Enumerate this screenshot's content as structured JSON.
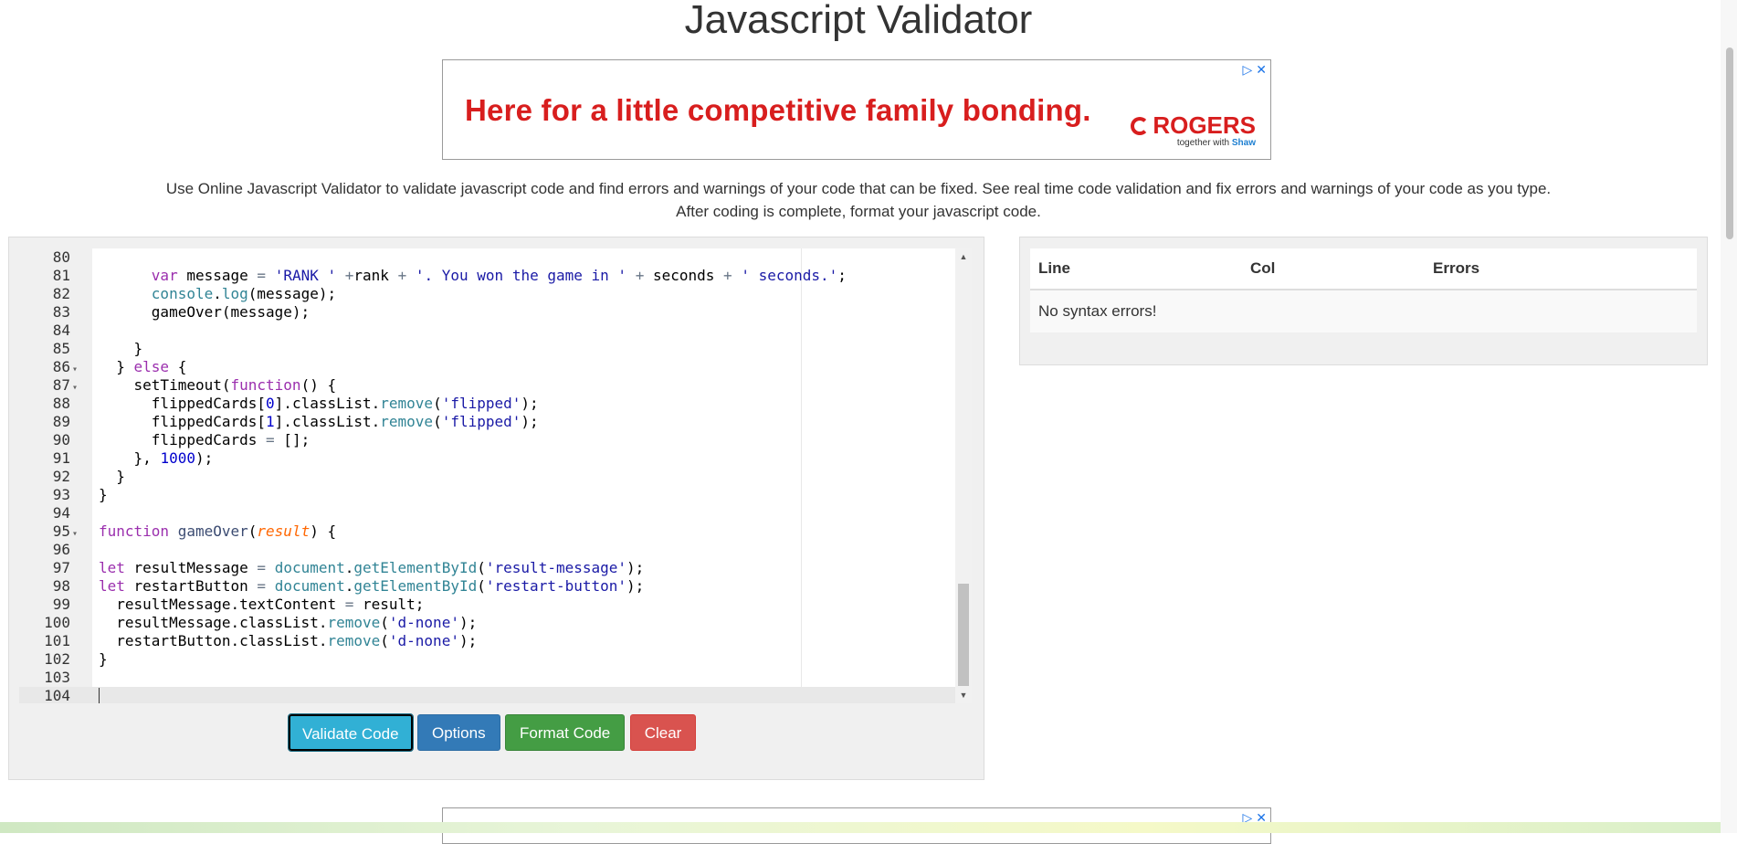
{
  "page": {
    "title": "Javascript Validator",
    "description": "Use Online Javascript Validator to validate javascript code and find errors and warnings of your code that can be fixed. See real time code validation and fix errors and warnings of your code as you type. After coding is complete, format your javascript code."
  },
  "ad": {
    "headline": "Here for a little competitive family bonding.",
    "brand": "ROGERS",
    "tagline_prefix": "together with",
    "tagline_partner": "Shaw",
    "adchoices_icon": "adchoices-icon",
    "close_icon": "close-icon"
  },
  "editor": {
    "lines": [
      {
        "n": "80",
        "fold": "",
        "html": ""
      },
      {
        "n": "81",
        "fold": "",
        "html": "      <span class='kw'>var</span> message <span class='op'>=</span> <span class='str'>'RANK '</span> <span class='op'>+</span>rank <span class='op'>+</span> <span class='str'>'. You won the game in '</span> <span class='op'>+</span> seconds <span class='op'>+</span> <span class='str'>' seconds.'</span>;"
      },
      {
        "n": "82",
        "fold": "",
        "html": "      <span class='sup'>console</span>.<span class='sup'>log</span>(message);"
      },
      {
        "n": "83",
        "fold": "",
        "html": "      gameOver(message);"
      },
      {
        "n": "84",
        "fold": "",
        "html": ""
      },
      {
        "n": "85",
        "fold": "",
        "html": "    }"
      },
      {
        "n": "86",
        "fold": "▾",
        "html": "  } <span class='kw'>else</span> {"
      },
      {
        "n": "87",
        "fold": "▾",
        "html": "    setTimeout(<span class='kw'>function</span>() {"
      },
      {
        "n": "88",
        "fold": "",
        "html": "      flippedCards[<span class='num'>0</span>].classList.<span class='sup'>remove</span>(<span class='str'>'flipped'</span>);"
      },
      {
        "n": "89",
        "fold": "",
        "html": "      flippedCards[<span class='num'>1</span>].classList.<span class='sup'>remove</span>(<span class='str'>'flipped'</span>);"
      },
      {
        "n": "90",
        "fold": "",
        "html": "      flippedCards <span class='op'>=</span> [];"
      },
      {
        "n": "91",
        "fold": "",
        "html": "    }, <span class='num'>1000</span>);"
      },
      {
        "n": "92",
        "fold": "",
        "html": "  }"
      },
      {
        "n": "93",
        "fold": "",
        "html": "}"
      },
      {
        "n": "94",
        "fold": "",
        "html": ""
      },
      {
        "n": "95",
        "fold": "▾",
        "html": "<span class='kw'>function</span> <span class='fn'>gameOver</span>(<span class='par'>result</span>) {"
      },
      {
        "n": "96",
        "fold": "",
        "html": ""
      },
      {
        "n": "97",
        "fold": "",
        "html": "<span class='kw'>let</span> resultMessage <span class='op'>=</span> <span class='sup'>document</span>.<span class='sup'>getElementById</span>(<span class='str'>'result-message'</span>);"
      },
      {
        "n": "98",
        "fold": "",
        "html": "<span class='kw'>let</span> restartButton <span class='op'>=</span> <span class='sup'>document</span>.<span class='sup'>getElementById</span>(<span class='str'>'restart-button'</span>);"
      },
      {
        "n": "99",
        "fold": "",
        "html": "  resultMessage.textContent <span class='op'>=</span> result;"
      },
      {
        "n": "100",
        "fold": "",
        "html": "  resultMessage.classList.<span class='sup'>remove</span>(<span class='str'>'d-none'</span>);"
      },
      {
        "n": "101",
        "fold": "",
        "html": "  restartButton.classList.<span class='sup'>remove</span>(<span class='str'>'d-none'</span>);"
      },
      {
        "n": "102",
        "fold": "",
        "html": "}"
      },
      {
        "n": "103",
        "fold": "",
        "html": ""
      },
      {
        "n": "104",
        "fold": "",
        "html": ""
      }
    ]
  },
  "buttons": {
    "validate": "Validate Code",
    "options": "Options",
    "format": "Format Code",
    "clear": "Clear"
  },
  "results": {
    "col_line": "Line",
    "col_col": "Col",
    "col_errors": "Errors",
    "message": "No syntax errors!"
  },
  "colors": {
    "validate": "#31b0d5",
    "options": "#337ab7",
    "format": "#449d44",
    "clear": "#d9534f",
    "ad_red": "#d81e1e"
  }
}
